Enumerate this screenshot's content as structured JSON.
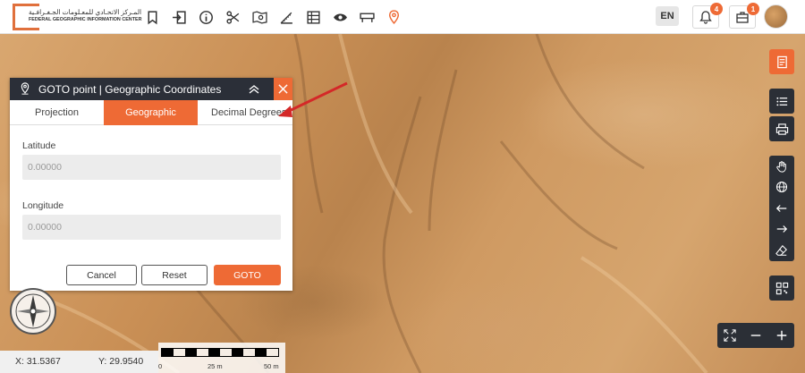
{
  "header": {
    "logo_arabic": "المـركز الاتحـادي للمعـلومات الجـغـرافـية",
    "logo_english": "FEDERAL GEOGRAPHIC INFORMATION CENTER",
    "tools": [
      "bookmark-icon",
      "sign-in-icon",
      "info-icon",
      "scissors-icon",
      "map-search-icon",
      "measure-ruler-icon",
      "table-icon",
      "eye-icon",
      "sign-board-icon",
      "location-pin-icon"
    ],
    "language": "EN",
    "notifications_count": "4",
    "messages_count": "1"
  },
  "panel": {
    "title": "GOTO point | Geographic Coordinates",
    "tabs": [
      {
        "label": "Projection",
        "active": false
      },
      {
        "label": "Geographic",
        "active": true
      },
      {
        "label": "Decimal Degrees",
        "active": false
      }
    ],
    "latitude_label": "Latitude",
    "latitude_placeholder": "0.00000",
    "longitude_label": "Longitude",
    "longitude_placeholder": "0.00000",
    "cancel_label": "Cancel",
    "reset_label": "Reset",
    "goto_label": "GOTO"
  },
  "status": {
    "x_coord": "X: 31.5367",
    "y_coord": "Y: 29.9540",
    "scale_labels": [
      "0",
      "25 m",
      "50 m"
    ]
  },
  "right_toolbar": [
    "report-icon",
    "list-icon",
    "print-icon",
    "pan-hand-icon",
    "globe-icon",
    "arrow-left-icon",
    "arrow-right-icon",
    "eraser-icon",
    "qr-code-icon"
  ],
  "zoom_bar": [
    "fullscreen-icon",
    "zoom-out-icon",
    "zoom-in-icon"
  ],
  "colors": {
    "accent": "#ee6a35",
    "dark": "#2b2f36"
  }
}
